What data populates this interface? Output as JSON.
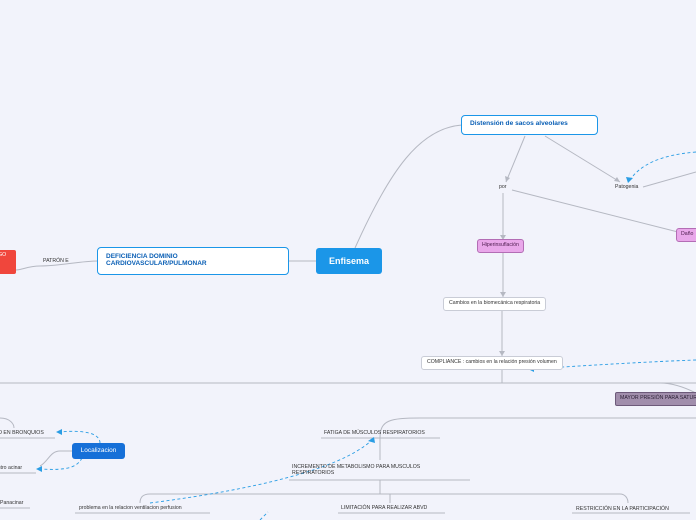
{
  "center": "Enfisema",
  "main_topic": "DEFICIENCIA DOMINIO CARDIOVASCULAR/PULMONAR",
  "left_label": "PATRÓN E",
  "left_red": "RIESGO",
  "distension": "Distensión de sacos alveolares",
  "por": "por",
  "patogenia": "Patogenia",
  "dano": "Daño",
  "hiperinsuflacion": "Hiperinsuflación",
  "cambios": "Cambios en la biomecánica respiratoria",
  "compliance": "COMPLIANCE : cambios en la relación presión volumen",
  "mayor_presion": "MAYOR PRESIÓN PARA SATURAR",
  "fatiga": "FATIGA DE MÚSCULOS RESPIRATORIOS",
  "incremento": "INCREMENTO DE METABOLISMO PARA MUSCULOS RESPIRATORIOS",
  "limitacion": "LIMITACIÓN PARA REALIZAR ABVD",
  "restriccion": "RESTRICCIÓN EN LA PARTICIPACIÓN",
  "problema": "problema en la relacion ventilacion perfusion",
  "localizacion": "Localizacion",
  "bronquios": "DAÑO EN BRONQUIOS",
  "centro_acinar": "Centro acinar",
  "panacinar": "Panacinar",
  "colors": {
    "background": "#f2f3fb",
    "center": "#1b96e8",
    "pink": "#e9a7ea",
    "purple": "#a18eac",
    "red": "#f0463c",
    "localizacion": "#1670d8"
  }
}
